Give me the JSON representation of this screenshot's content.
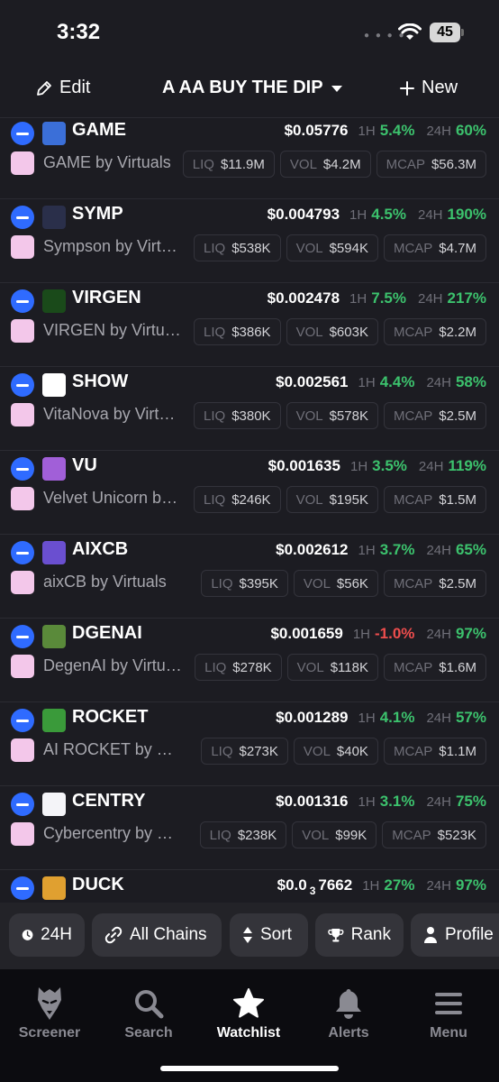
{
  "status": {
    "time": "3:32",
    "battery": "45"
  },
  "header": {
    "edit_label": "Edit",
    "title": "A AA BUY THE DIP",
    "new_label": "New"
  },
  "labels": {
    "h1": "1H",
    "h24": "24H",
    "liq": "LIQ",
    "vol": "VOL",
    "mcap": "MCAP"
  },
  "rows": [
    {
      "symbol": "GAME",
      "name": "GAME by Virtuals",
      "price": "$0.05776",
      "change_1h": "5.4%",
      "change_24h": "60%",
      "liq": "$11.9M",
      "vol": "$4.2M",
      "mcap": "$56.3M"
    },
    {
      "symbol": "SYMP",
      "name": "Sympson by Virtuals",
      "price": "$0.004793",
      "change_1h": "4.5%",
      "change_24h": "190%",
      "liq": "$538K",
      "vol": "$594K",
      "mcap": "$4.7M"
    },
    {
      "symbol": "VIRGEN",
      "name": "VIRGEN by Virtuals",
      "price": "$0.002478",
      "change_1h": "7.5%",
      "change_24h": "217%",
      "liq": "$386K",
      "vol": "$603K",
      "mcap": "$2.2M"
    },
    {
      "symbol": "SHOW",
      "name": "VitaNova by Virtuals",
      "price": "$0.002561",
      "change_1h": "4.4%",
      "change_24h": "58%",
      "liq": "$380K",
      "vol": "$578K",
      "mcap": "$2.5M"
    },
    {
      "symbol": "VU",
      "name": "Velvet Unicorn by Virtuals",
      "price": "$0.001635",
      "change_1h": "3.5%",
      "change_24h": "119%",
      "liq": "$246K",
      "vol": "$195K",
      "mcap": "$1.5M"
    },
    {
      "symbol": "AIXCB",
      "name": "aixCB by Virtuals",
      "price": "$0.002612",
      "change_1h": "3.7%",
      "change_24h": "65%",
      "liq": "$395K",
      "vol": "$56K",
      "mcap": "$2.5M"
    },
    {
      "symbol": "DGENAI",
      "name": "DegenAI by Virtuals",
      "price": "$0.001659",
      "change_1h": "-1.0%",
      "change_24h": "97%",
      "liq": "$278K",
      "vol": "$118K",
      "mcap": "$1.6M"
    },
    {
      "symbol": "ROCKET",
      "name": "AI ROCKET by Virtuals",
      "price": "$0.001289",
      "change_1h": "4.1%",
      "change_24h": "57%",
      "liq": "$273K",
      "vol": "$40K",
      "mcap": "$1.1M"
    },
    {
      "symbol": "CENTRY",
      "name": "Cybercentry by Virtuals",
      "price": "$0.001316",
      "change_1h": "3.1%",
      "change_24h": "75%",
      "liq": "$238K",
      "vol": "$99K",
      "mcap": "$523K"
    }
  ],
  "partial_row": {
    "symbol": "DUCK",
    "price_prefix": "$0.0",
    "price_sub": "3",
    "price_rest": "7662",
    "change_1h": "27%",
    "change_24h": "97%"
  },
  "filters": {
    "timeframe": "24H",
    "chains": "All Chains",
    "sort": "Sort",
    "rank": "Rank",
    "profile": "Profile"
  },
  "tabs": {
    "screener": "Screener",
    "search": "Search",
    "watchlist": "Watchlist",
    "alerts": "Alerts",
    "menu": "Menu"
  },
  "colors": {
    "positive": "#3cc26d",
    "negative": "#ee4d4d",
    "accent": "#2f6bff"
  }
}
